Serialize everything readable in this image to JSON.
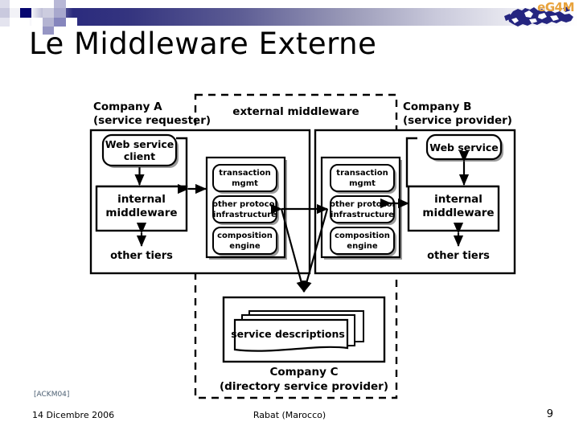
{
  "slide": {
    "title": "Le Middleware Externe",
    "page_number": "9"
  },
  "logo": {
    "text": "eG4M",
    "text_color": "#e8a33d",
    "map_color": "#252580"
  },
  "theme": {
    "band_dark": "#2b2b7e",
    "band_mid": "#9a9ab8",
    "band_light": "#eaeaf1",
    "citation_color": "#4d6073"
  },
  "diagram": {
    "external_zone_label": "external middleware",
    "company_a": {
      "title_line1": "Company A",
      "title_line2": "(service requester)",
      "web_client_line1": "Web service",
      "web_client_line2": "client",
      "internal_line1": "internal",
      "internal_line2": "middleware",
      "other_tiers": "other tiers"
    },
    "company_b": {
      "title_line1": "Company B",
      "title_line2": "(service provider)",
      "web_service": "Web service",
      "internal_line1": "internal",
      "internal_line2": "middleware",
      "other_tiers": "other tiers"
    },
    "company_c": {
      "title_line1": "Company C",
      "title_line2": "(directory service provider)",
      "service_descriptions": "service descriptions"
    },
    "middleware_stack_left": [
      {
        "line1": "transaction",
        "line2": "mgmt"
      },
      {
        "line1": "other protocol",
        "line2": "infrastructure"
      },
      {
        "line1": "composition",
        "line2": "engine"
      }
    ],
    "middleware_stack_right": [
      {
        "line1": "transaction",
        "line2": "mgmt"
      },
      {
        "line1": "other protocol",
        "line2": "infrastructure"
      },
      {
        "line1": "composition",
        "line2": "engine"
      }
    ]
  },
  "footer": {
    "citation": "[ACKM04]",
    "date": "14 Dicembre 2006",
    "place": "Rabat (Marocco)"
  }
}
